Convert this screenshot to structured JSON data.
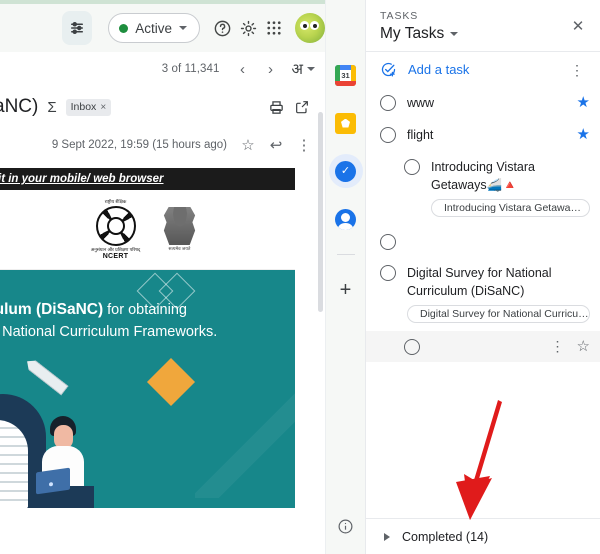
{
  "gmail": {
    "topbar": {
      "tune_icon": "tune-icon",
      "status_label": "Active",
      "help_icon": "help-icon",
      "settings_icon": "gear-icon",
      "apps_icon": "apps-grid-icon",
      "avatar": "avatar"
    },
    "nav": {
      "count": "3 of 11,341",
      "prev_icon": "chevron-left-icon",
      "next_icon": "chevron-right-icon",
      "language_label": "अ"
    },
    "thread": {
      "subject": "aNC)",
      "sigma_icon": "sigma-icon",
      "label_chip": "Inbox",
      "label_remove": "×",
      "print_icon": "print-icon",
      "popout_icon": "open-in-new-icon",
      "date": "9 Sept 2022, 19:59 (15 hours ago)",
      "star_icon": "star-icon",
      "reply_icon": "reply-icon",
      "more_icon": "more-vert-icon"
    },
    "email": {
      "banner_text": "it in your mobile/ web browser",
      "ncert_top": "राष्ट्रीय शैक्षिक",
      "ncert_mid": "अनुसंधान और प्रशिक्षण परिषद्",
      "ncert_acronym": "NCERT",
      "emblem_caption": "सत्यमेव जयते",
      "headline_bold": "culum (DiSaNC)",
      "headline_rest": " for obtaining",
      "headline_line2": "of National Curriculum Frameworks."
    }
  },
  "rail": {
    "items": [
      {
        "name": "google-calendar-icon",
        "day": "31"
      },
      {
        "name": "google-keep-icon"
      },
      {
        "name": "google-tasks-icon"
      },
      {
        "name": "google-contacts-icon"
      }
    ],
    "add_label": "+",
    "info_icon": "info-icon"
  },
  "tasks": {
    "kicker": "TASKS",
    "title": "My Tasks",
    "close_icon": "close-icon",
    "add_task_label": "Add a task",
    "add_task_icon": "add-task-icon",
    "list_menu_icon": "more-vert-icon",
    "items": [
      {
        "title": "www",
        "starred": true,
        "indent": 0,
        "chip": null,
        "hovered": false
      },
      {
        "title": "flight",
        "starred": true,
        "indent": 0,
        "chip": null,
        "hovered": false
      },
      {
        "title": "Introducing Vistara Getaways🚄🔺",
        "starred": false,
        "indent": 1,
        "chip": "Introducing Vistara Getawa…",
        "hovered": false
      },
      {
        "title": "",
        "starred": false,
        "indent": 0,
        "chip": null,
        "hovered": false
      },
      {
        "title": "Digital Survey for National Curriculum (DiSaNC)",
        "starred": false,
        "indent": 0,
        "chip": "Digital Survey for National Curricu…",
        "hovered": false
      },
      {
        "title": "",
        "starred": false,
        "indent": 1,
        "chip": null,
        "hovered": true
      }
    ],
    "completed_label": "Completed (14)",
    "completed_expander": "expand-triangle-icon"
  },
  "annotation": {
    "arrow_color": "#e01b1b",
    "arrow_name": "red-pointer-arrow"
  },
  "colors": {
    "accent_blue": "#1a73e8",
    "teal": "#17878a",
    "orange": "#f0a73c",
    "green_dot": "#1e8e3e"
  }
}
